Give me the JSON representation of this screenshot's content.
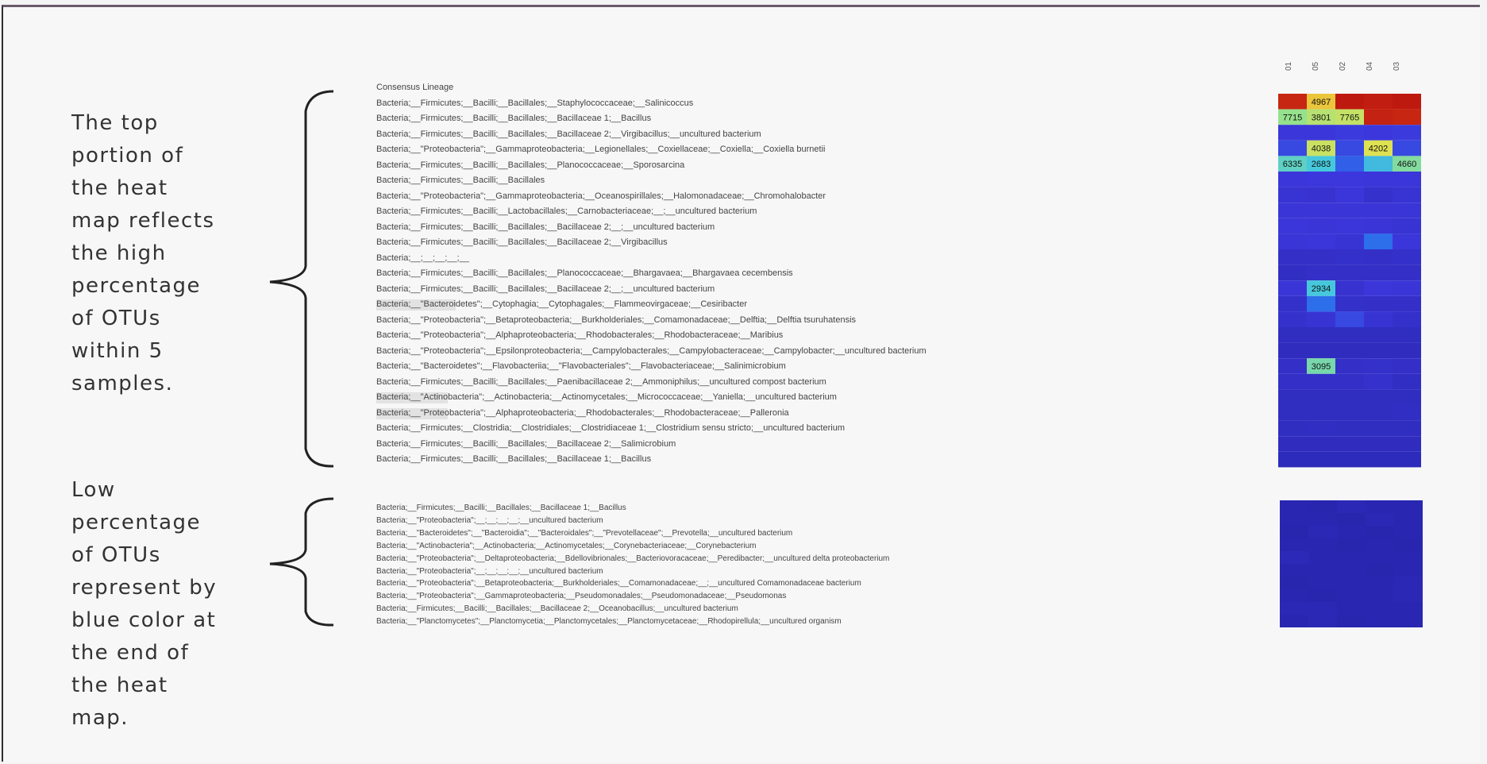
{
  "annotations": {
    "top": [
      "The top",
      "portion of",
      "the heat",
      "map reflects",
      "the  high",
      "percentage",
      "of OTUs",
      "within 5",
      "samples."
    ],
    "low": [
      "Low",
      "percentage",
      "of OTUs",
      "represent by",
      "blue color at",
      "the end of",
      "the heat",
      "map."
    ]
  },
  "colors": {
    "annotation_text": "#333333",
    "brace": "#222222",
    "heatmap_low": "#2e2db8",
    "heatmap_high": "#c81b10"
  },
  "chart_data": {
    "type": "heatmap",
    "title": "",
    "row_header": "Consensus Lineage",
    "columns": [
      "01",
      "05",
      "02",
      "04",
      "03"
    ],
    "rows": [
      "Bacteria;__Firmicutes;__Bacilli;__Bacillales;__Staphylococcaceae;__Salinicoccus",
      "Bacteria;__Firmicutes;__Bacilli;__Bacillales;__Bacillaceae 1;__Bacillus",
      "Bacteria;__Firmicutes;__Bacilli;__Bacillales;__Bacillaceae 2;__Virgibacillus;__uncultured bacterium",
      "Bacteria;__\"Proteobacteria\";__Gammaproteobacteria;__Legionellales;__Coxiellaceae;__Coxiella;__Coxiella burnetii",
      "Bacteria;__Firmicutes;__Bacilli;__Bacillales;__Planococcaceae;__Sporosarcina",
      "Bacteria;__Firmicutes;__Bacilli;__Bacillales",
      "Bacteria;__\"Proteobacteria\";__Gammaproteobacteria;__Oceanospirillales;__Halomonadaceae;__Chromohalobacter",
      "Bacteria;__Firmicutes;__Bacilli;__Lactobacillales;__Carnobacteriaceae;__;__uncultured bacterium",
      "Bacteria;__Firmicutes;__Bacilli;__Bacillales;__Bacillaceae 2;__;__uncultured bacterium",
      "Bacteria;__Firmicutes;__Bacilli;__Bacillales;__Bacillaceae 2;__Virgibacillus",
      "Bacteria;__;__;__;__;__",
      "Bacteria;__Firmicutes;__Bacilli;__Bacillales;__Planococcaceae;__Bhargavaea;__Bhargavaea cecembensis",
      "Bacteria;__Firmicutes;__Bacilli;__Bacillales;__Bacillaceae 2;__;__uncultured bacterium",
      "Bacteria;__\"Bacteroidetes\";__Cytophagia;__Cytophagales;__Flammeovirgaceae;__Cesiribacter",
      "Bacteria;__\"Proteobacteria\";__Betaproteobacteria;__Burkholderiales;__Comamonadaceae;__Delftia;__Delftia tsuruhatensis",
      "Bacteria;__\"Proteobacteria\";__Alphaproteobacteria;__Rhodobacterales;__Rhodobacteraceae;__Maribius",
      "Bacteria;__\"Proteobacteria\";__Epsilonproteobacteria;__Campylobacterales;__Campylobacteraceae;__Campylobacter;__uncultured bacterium",
      "Bacteria;__\"Bacteroidetes\";__Flavobacteriia;__\"Flavobacteriales\";__Flavobacteriaceae;__Salinimicrobium",
      "Bacteria;__Firmicutes;__Bacilli;__Bacillales;__Paenibacillaceae 2;__Ammoniphilus;__uncultured compost bacterium",
      "Bacteria;__\"Actinobacteria\";__Actinobacteria;__Actinomycetales;__Micrococcaceae;__Yaniella;__uncultured bacterium",
      "Bacteria;__\"Proteobacteria\";__Alphaproteobacteria;__Rhodobacterales;__Rhodobacteraceae;__Palleronia",
      "Bacteria;__Firmicutes;__Clostridia;__Clostridiales;__Clostridiaceae 1;__Clostridium sensu stricto;__uncultured bacterium",
      "Bacteria;__Firmicutes;__Bacilli;__Bacillales;__Bacillaceae 2;__Salimicrobium",
      "Bacteria;__Firmicutes;__Bacilli;__Bacillales;__Bacillaceae 1;__Bacillus"
    ],
    "values": [
      [
        null,
        4967,
        null,
        null,
        null
      ],
      [
        7715,
        3801,
        7765,
        null,
        null
      ],
      [
        null,
        null,
        null,
        null,
        null
      ],
      [
        null,
        4038,
        null,
        4202,
        null
      ],
      [
        6335,
        2683,
        null,
        null,
        4660
      ],
      [
        null,
        null,
        null,
        null,
        null
      ],
      [
        null,
        null,
        null,
        null,
        null
      ],
      [
        null,
        null,
        null,
        null,
        null
      ],
      [
        null,
        null,
        null,
        null,
        null
      ],
      [
        null,
        null,
        null,
        null,
        null
      ],
      [
        null,
        null,
        null,
        null,
        null
      ],
      [
        null,
        null,
        null,
        null,
        null
      ],
      [
        null,
        2934,
        null,
        null,
        null
      ],
      [
        null,
        null,
        null,
        null,
        null
      ],
      [
        null,
        null,
        null,
        null,
        null
      ],
      [
        null,
        null,
        null,
        null,
        null
      ],
      [
        null,
        null,
        null,
        null,
        null
      ],
      [
        null,
        3095,
        null,
        null,
        null
      ],
      [
        null,
        null,
        null,
        null,
        null
      ],
      [
        null,
        null,
        null,
        null,
        null
      ],
      [
        null,
        null,
        null,
        null,
        null
      ],
      [
        null,
        null,
        null,
        null,
        null
      ],
      [
        null,
        null,
        null,
        null,
        null
      ],
      [
        null,
        null,
        null,
        null,
        null
      ]
    ],
    "intensity": [
      [
        0.97,
        0.72,
        1.0,
        0.99,
        1.0
      ],
      [
        0.55,
        0.6,
        0.62,
        0.98,
        0.97
      ],
      [
        0.14,
        0.14,
        0.16,
        0.15,
        0.16
      ],
      [
        0.2,
        0.63,
        0.2,
        0.66,
        0.2
      ],
      [
        0.46,
        0.42,
        0.26,
        0.4,
        0.52
      ],
      [
        0.14,
        0.15,
        0.15,
        0.14,
        0.14
      ],
      [
        0.12,
        0.11,
        0.14,
        0.1,
        0.12
      ],
      [
        0.13,
        0.13,
        0.13,
        0.13,
        0.13
      ],
      [
        0.14,
        0.13,
        0.14,
        0.13,
        0.12
      ],
      [
        0.13,
        0.14,
        0.12,
        0.3,
        0.14
      ],
      [
        0.08,
        0.08,
        0.09,
        0.08,
        0.09
      ],
      [
        0.07,
        0.08,
        0.08,
        0.08,
        0.08
      ],
      [
        0.13,
        0.42,
        0.11,
        0.14,
        0.13
      ],
      [
        0.09,
        0.3,
        0.09,
        0.08,
        0.08
      ],
      [
        0.1,
        0.12,
        0.2,
        0.12,
        0.09
      ],
      [
        0.06,
        0.06,
        0.06,
        0.06,
        0.06
      ],
      [
        0.05,
        0.05,
        0.05,
        0.05,
        0.05
      ],
      [
        0.08,
        0.5,
        0.08,
        0.09,
        0.08
      ],
      [
        0.08,
        0.08,
        0.08,
        0.1,
        0.07
      ],
      [
        0.06,
        0.06,
        0.06,
        0.06,
        0.06
      ],
      [
        0.06,
        0.06,
        0.06,
        0.06,
        0.07
      ],
      [
        0.06,
        0.07,
        0.06,
        0.06,
        0.06
      ],
      [
        0.05,
        0.05,
        0.05,
        0.05,
        0.05
      ],
      [
        0.04,
        0.04,
        0.04,
        0.04,
        0.04
      ]
    ],
    "low_rows": [
      "Bacteria;__Firmicutes;__Bacilli;__Bacillales;__Bacillaceae 1;__Bacillus",
      "Bacteria;__\"Proteobacteria\";__;__;__;__;__uncultured bacterium",
      "Bacteria;__\"Bacteroidetes\";__\"Bacteroidia\";__\"Bacteroidales\";__\"Prevotellaceae\";__Prevotella;__uncultured bacterium",
      "Bacteria;__\"Actinobacteria\";__Actinobacteria;__Actinomycetales;__Corynebacteriaceae;__Corynebacterium",
      "Bacteria;__\"Proteobacteria\";__Deltaproteobacteria;__Bdellovibrionales;__Bacteriovoracaceae;__Peredibacter;__uncultured delta proteobacterium",
      "Bacteria;__\"Proteobacteria\";__;__;__;__;__uncultured bacterium",
      "Bacteria;__\"Proteobacteria\";__Betaproteobacteria;__Burkholderiales;__Comamonadaceae;__;__uncultured Comamonadaceae bacterium",
      "Bacteria;__\"Proteobacteria\";__Gammaproteobacteria;__Pseudomonadales;__Pseudomonadaceae;__Pseudomonas",
      "Bacteria;__Firmicutes;__Bacilli;__Bacillales;__Bacillaceae 2;__Oceanobacillus;__uncultured bacterium",
      "Bacteria;__\"Planctomycetes\";__Planctomycetia;__Planctomycetales;__Planctomycetaceae;__Rhodopirellula;__uncultured organism"
    ],
    "low_intensity": [
      [
        0.01,
        0.0,
        0.02,
        0.01,
        0.01
      ],
      [
        0.01,
        0.01,
        0.0,
        0.02,
        0.01
      ],
      [
        0.0,
        0.02,
        0.01,
        0.0,
        0.01
      ],
      [
        0.01,
        0.01,
        0.0,
        0.01,
        0.0
      ],
      [
        0.03,
        0.01,
        0.01,
        0.01,
        0.01
      ],
      [
        0.01,
        0.01,
        0.01,
        0.0,
        0.01
      ],
      [
        0.0,
        0.01,
        0.01,
        0.01,
        0.02
      ],
      [
        0.01,
        0.0,
        0.01,
        0.01,
        0.02
      ],
      [
        0.02,
        0.02,
        0.01,
        0.01,
        0.01
      ],
      [
        0.01,
        0.02,
        0.0,
        0.01,
        0.01
      ]
    ]
  }
}
